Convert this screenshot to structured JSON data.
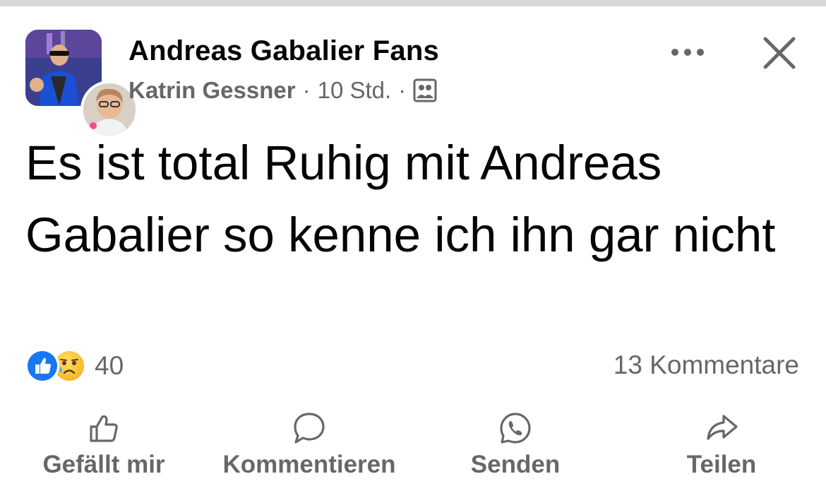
{
  "post": {
    "group_name": "Andreas Gabalier Fans",
    "author": "Katrin Gessner",
    "separator": "·",
    "time": "10 Std.",
    "audience_icon": "group-members-icon",
    "text": "Es ist total Ruhig mit Andreas Gabalier so kenne ich ihn gar nicht"
  },
  "header_actions": {
    "more_icon": "more-dots-icon",
    "close_icon": "close-icon"
  },
  "stats": {
    "reactions": [
      "like",
      "sad"
    ],
    "reaction_count": "40",
    "comments": "13 Kommentare"
  },
  "actions": {
    "like": {
      "label": "Gefällt mir",
      "icon": "thumbs-up-icon"
    },
    "comment": {
      "label": "Kommentieren",
      "icon": "comment-bubble-icon"
    },
    "send": {
      "label": "Senden",
      "icon": "whatsapp-icon"
    },
    "share": {
      "label": "Teilen",
      "icon": "share-arrow-icon"
    }
  },
  "colors": {
    "primary_text": "#050505",
    "secondary_text": "#65676b",
    "like_blue": "#1877f2",
    "sad_yellow": "#f7b928"
  }
}
